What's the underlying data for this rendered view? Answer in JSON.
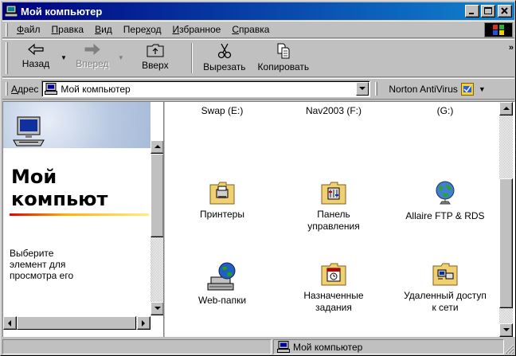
{
  "window": {
    "title": "Мой компьютер"
  },
  "menubar": {
    "items": [
      {
        "pre": "",
        "u": "Ф",
        "post": "айл"
      },
      {
        "pre": "",
        "u": "П",
        "post": "равка"
      },
      {
        "pre": "",
        "u": "В",
        "post": "ид"
      },
      {
        "pre": "Пере",
        "u": "х",
        "post": "од"
      },
      {
        "pre": "",
        "u": "И",
        "post": "збранное"
      },
      {
        "pre": "",
        "u": "С",
        "post": "правка"
      }
    ]
  },
  "toolbar": {
    "back_label": "Назад",
    "forward_label": "Вперед",
    "up_label": "Вверх",
    "cut_label": "Вырезать",
    "copy_label": "Копировать"
  },
  "address": {
    "label_u": "А",
    "label_rest": "дрес",
    "value": "Мой компьютер",
    "norton_label": "Norton AntiVirus"
  },
  "left_pane": {
    "title": "Мой\nкомпьют",
    "description": "Выберите\nэлемент для\nпросмотра его"
  },
  "drives": [
    {
      "label": "Swap (E:)"
    },
    {
      "label": "Nav2003 (F:)"
    },
    {
      "label": "(G:)"
    }
  ],
  "items": [
    {
      "label": "Принтеры",
      "icon": "printers-folder-icon"
    },
    {
      "label": "Панель\nуправления",
      "icon": "control-panel-folder-icon"
    },
    {
      "label": "Allaire FTP & RDS",
      "icon": "globe-icon"
    },
    {
      "label": "Web-папки",
      "icon": "web-folders-icon"
    },
    {
      "label": "Назначенные\nзадания",
      "icon": "scheduled-tasks-folder-icon"
    },
    {
      "label": "Удаленный доступ\nк сети",
      "icon": "dialup-networking-folder-icon"
    }
  ],
  "statusbar": {
    "location": "Мой компьютер"
  },
  "colors": {
    "title_start": "#000080",
    "title_end": "#1084d0",
    "face": "#c0c0c0",
    "folder": "#f0d070"
  }
}
